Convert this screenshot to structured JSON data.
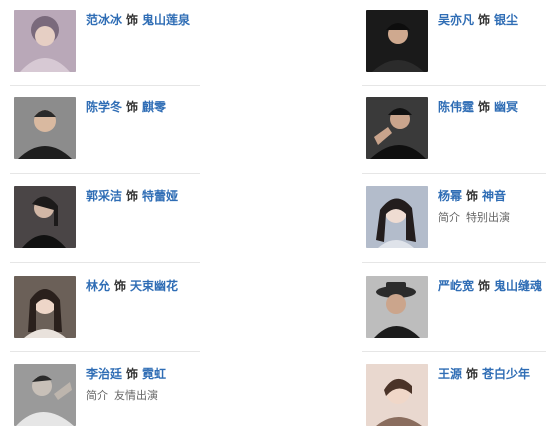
{
  "cast": [
    {
      "actor": "范冰冰",
      "as": "饰",
      "role": "鬼山莲泉",
      "note_label": "",
      "note_value": ""
    },
    {
      "actor": "吴亦凡",
      "as": "饰",
      "role": "银尘",
      "note_label": "",
      "note_value": ""
    },
    {
      "actor": "陈学冬",
      "as": "饰",
      "role": "麒零",
      "note_label": "",
      "note_value": ""
    },
    {
      "actor": "陈伟霆",
      "as": "饰",
      "role": "幽冥",
      "note_label": "",
      "note_value": ""
    },
    {
      "actor": "郭采洁",
      "as": "饰",
      "role": "特蕾娅",
      "note_label": "",
      "note_value": ""
    },
    {
      "actor": "杨幂",
      "as": "饰",
      "role": "神音",
      "note_label": "简介",
      "note_value": "特别出演"
    },
    {
      "actor": "林允",
      "as": "饰",
      "role": "天束幽花",
      "note_label": "",
      "note_value": ""
    },
    {
      "actor": "严屹宽",
      "as": "饰",
      "role": "鬼山缝魂",
      "note_label": "",
      "note_value": ""
    },
    {
      "actor": "李治廷",
      "as": "饰",
      "role": "霓虹",
      "note_label": "简介",
      "note_value": "友情出演"
    },
    {
      "actor": "王源",
      "as": "饰",
      "role": "苍白少年",
      "note_label": "",
      "note_value": ""
    }
  ],
  "colors": {
    "link": "#2f6db5",
    "text": "#333333",
    "muted": "#666666",
    "divider": "#e6e6e6"
  }
}
